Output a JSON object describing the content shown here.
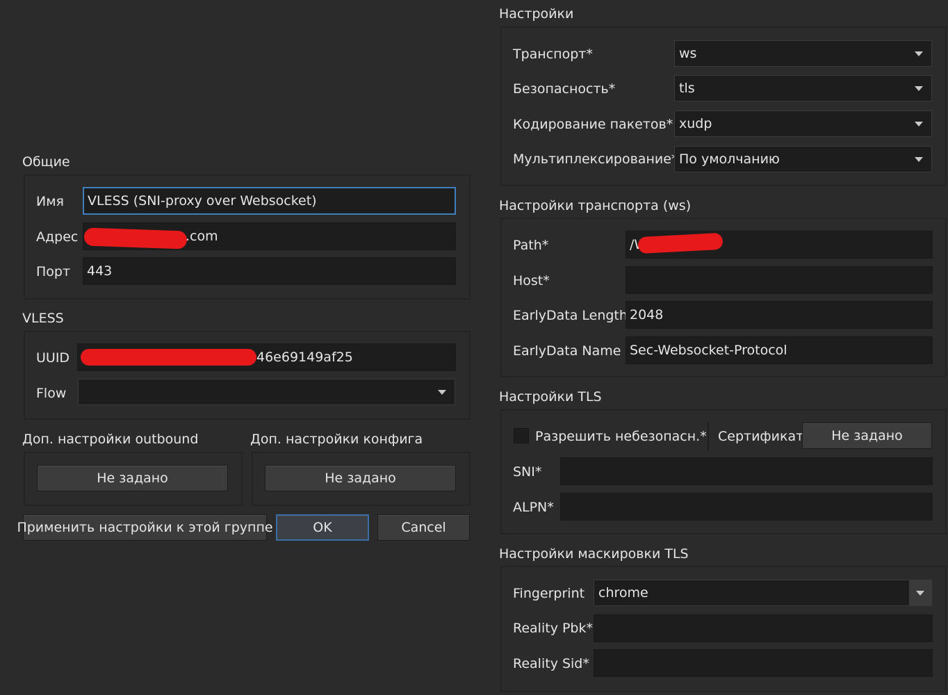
{
  "general": {
    "title": "Общие",
    "name_label": "Имя",
    "name_value": "VLESS (SNI-proxy over Websocket)",
    "address_label": "Адрес",
    "address_value": ".com",
    "port_label": "Порт",
    "port_value": "443"
  },
  "vless": {
    "title": "VLESS",
    "uuid_label": "UUID",
    "uuid_value": "46e69149af25",
    "flow_label": "Flow",
    "flow_value": ""
  },
  "outbound_extra": {
    "title": "Доп. настройки outbound",
    "button": "Не задано"
  },
  "config_extra": {
    "title": "Доп. настройки конфига",
    "button": "Не задано"
  },
  "actions": {
    "apply_group": "Применить настройки к этой группе",
    "ok": "OK",
    "cancel": "Cancel"
  },
  "settings": {
    "title": "Настройки",
    "transport_label": "Транспорт*",
    "transport_value": "ws",
    "security_label": "Безопасность*",
    "security_value": "tls",
    "packet_encoding_label": "Кодирование пакетов*",
    "packet_encoding_value": "xudp",
    "mux_label": "Мультиплексирование*",
    "mux_value": "По умолчанию"
  },
  "transport": {
    "title": "Настройки транспорта (ws)",
    "path_label": "Path*",
    "path_value": "/W",
    "host_label": "Host*",
    "host_value": "",
    "early_len_label": "EarlyData Length",
    "early_len_value": "2048",
    "early_name_label": "EarlyData Name",
    "early_name_value": "Sec-Websocket-Protocol"
  },
  "tls": {
    "title": "Настройки TLS",
    "allow_insecure_label": "Разрешить небезопасн.*",
    "cert_label": "Сертификат",
    "cert_button": "Не задано",
    "sni_label": "SNI*",
    "sni_value": "",
    "alpn_label": "ALPN*",
    "alpn_value": ""
  },
  "mask": {
    "title": "Настройки маскировки TLS",
    "fingerprint_label": "Fingerprint",
    "fingerprint_value": "chrome",
    "pbk_label": "Reality Pbk*",
    "pbk_value": "",
    "sid_label": "Reality Sid*",
    "sid_value": ""
  },
  "colors": {
    "background": "#2b2b2b",
    "field": "#1d1d1d",
    "focus_border": "#3f7fbf",
    "redaction": "#e8191a"
  }
}
